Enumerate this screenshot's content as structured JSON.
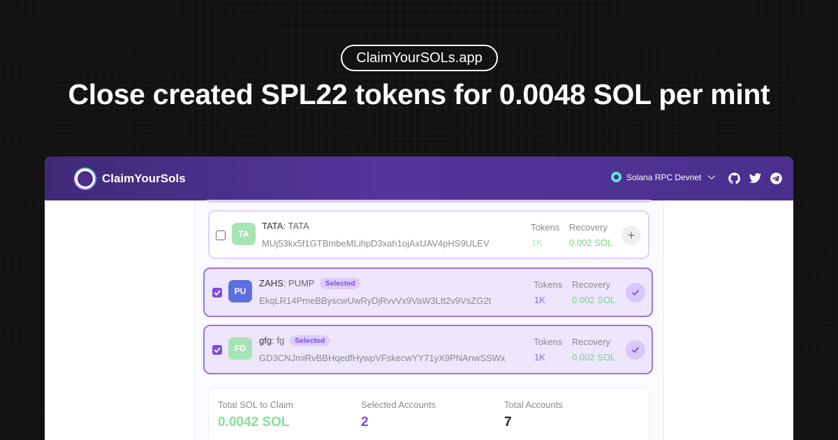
{
  "banner": {
    "pill_text": "ClaimYourSOLs.app",
    "headline": "Close created SPL22 tokens for 0.0048 SOL per mint"
  },
  "header": {
    "brand": "ClaimYourSols",
    "rpc_label": "Solana RPC Devnet",
    "icons": [
      "github-icon",
      "twitter-icon",
      "telegram-icon"
    ]
  },
  "columns": {
    "tokens": "Tokens",
    "recovery": "Recovery"
  },
  "tokens": [
    {
      "initials": "TA",
      "name": "TATA",
      "symbol": "TATA",
      "mint": "MUj53kx5f1GTBmbeMLihpD3xah1ojAxUAV4pHS9ULEV",
      "tokens": "1K",
      "recovery": "0.002 SOL",
      "selected": false,
      "avatar_color": "#a7e4b3",
      "badge": ""
    },
    {
      "initials": "PU",
      "name": "ZAHS",
      "symbol": "PUMP",
      "mint": "EkqLR14PmeBByscwUwRyDjRvvVx9VaW3Ltt2v9VsZG2t",
      "tokens": "1K",
      "recovery": "0.002 SOL",
      "selected": true,
      "avatar_color": "#5b6fe0",
      "badge": "Selected"
    },
    {
      "initials": "FG",
      "name": "gfg",
      "symbol": "fg",
      "mint": "GD3CNJmiRvBBHqedfHywpVFskecwYY71yX9PNAnwSSWx",
      "tokens": "1K",
      "recovery": "0.002 SOL",
      "selected": true,
      "avatar_color": "#a7e4b3",
      "badge": "Selected"
    }
  ],
  "summary": {
    "total_sol_label": "Total SOL to Claim",
    "total_sol_value": "0.0042 SOL",
    "selected_label": "Selected Accounts",
    "selected_value": "2",
    "total_label": "Total Accounts",
    "total_value": "7"
  },
  "colors": {
    "accent_purple": "#7c4ddb",
    "success_green": "#7bcf8b",
    "header_purple": "#4a2f8c"
  }
}
